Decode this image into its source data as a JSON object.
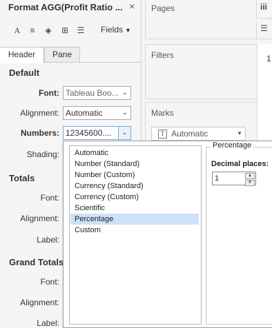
{
  "format_pane": {
    "title": "Format AGG(Profit Ratio ...",
    "close": "×",
    "toolbar": {
      "font_icon": "A",
      "alignment_icon": "≡",
      "shading_icon": "◈",
      "borders_icon": "⊞",
      "lines_icon": "☰",
      "fields_label": "Fields",
      "fields_caret": "▼"
    },
    "tabs": [
      "Header",
      "Pane"
    ],
    "default": {
      "section_title": "Default",
      "font_label": "Font:",
      "font_value": "Tableau Boo...",
      "alignment_label": "Alignment:",
      "alignment_value": "Automatic",
      "numbers_label": "Numbers:",
      "numbers_value": "12345600....",
      "shading_label": "Shading:"
    },
    "totals": {
      "section_title": "Totals",
      "font_label": "Font:",
      "alignment_label": "Alignment:",
      "label_label": "Label:"
    },
    "grand_totals": {
      "section_title": "Grand Totals",
      "font_label": "Font:",
      "alignment_label": "Alignment:",
      "label_label": "Label:"
    }
  },
  "shelves": {
    "pages": "Pages",
    "filters": "Filters",
    "marks": "Marks",
    "marks_type_icon": "T",
    "marks_type": "Automatic",
    "columns_icon": "iii",
    "rows_icon": "☰",
    "view_glyph": "1"
  },
  "number_popup": {
    "formats": [
      "Automatic",
      "Number (Standard)",
      "Number (Custom)",
      "Currency (Standard)",
      "Currency (Custom)",
      "Scientific",
      "Percentage",
      "Custom"
    ],
    "selected_format": "Percentage",
    "group_title": "Percentage",
    "decimal_label": "Decimal places:",
    "decimal_value": "1"
  },
  "colors": {
    "selection": "#cde1f7",
    "panel_bg": "#f5f5f5",
    "border": "#a9a9a9"
  }
}
